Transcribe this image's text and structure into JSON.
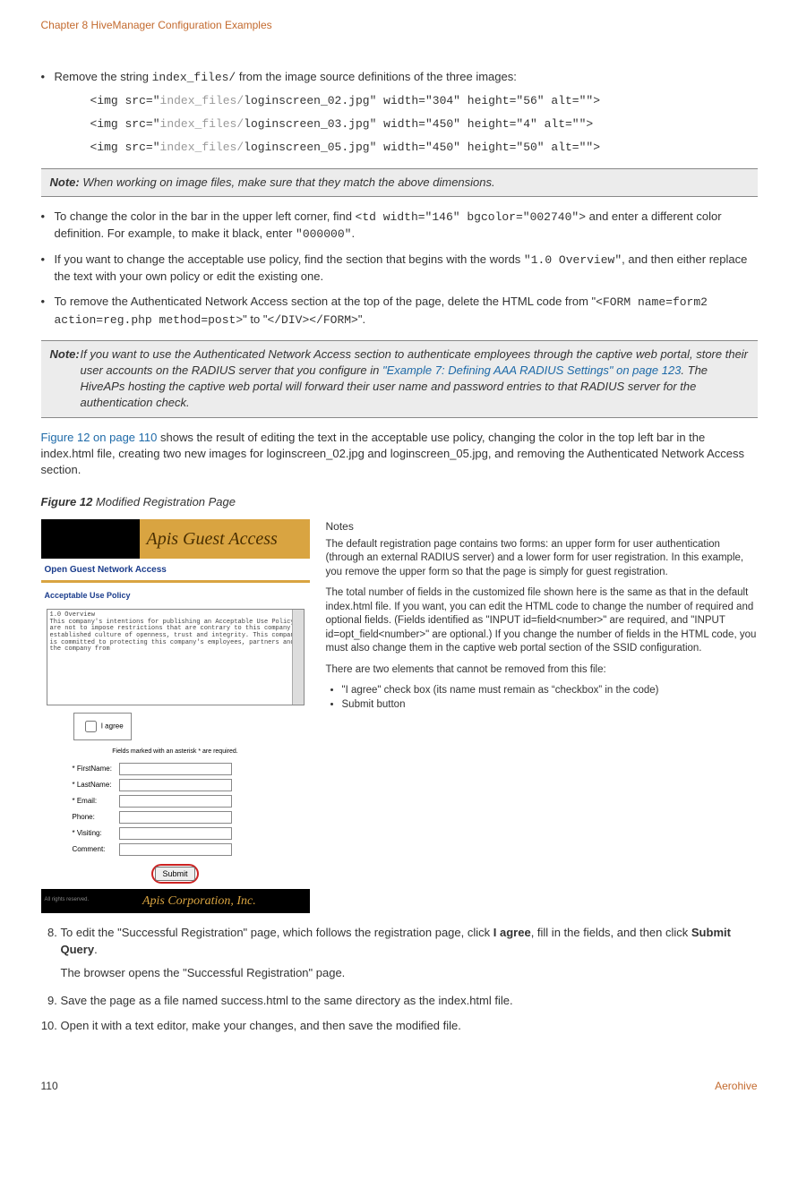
{
  "header": "Chapter 8 HiveManager Configuration Examples",
  "bullets1": {
    "b1_pre": "Remove the string ",
    "b1_code": "index_files/",
    "b1_post": " from the image source definitions of the three images:"
  },
  "code_lines": {
    "l1a": "<img src=\"",
    "l1g": "index_files/",
    "l1b": "loginscreen_02.jpg\" width=\"304\" height=\"56\" alt=\"\">",
    "l2a": "<img src=\"",
    "l2g": "index_files/",
    "l2b": "loginscreen_03.jpg\" width=\"450\" height=\"4\" alt=\"\">",
    "l3a": "<img src=\"",
    "l3g": "index_files/",
    "l3b": "loginscreen_05.jpg\" width=\"450\" height=\"50\" alt=\"\">"
  },
  "note1_label": "Note:",
  "note1_text": " When working on image files, make sure that they match the above dimensions.",
  "bullets2": {
    "b2a": "To change the color in the bar in the upper left corner, find ",
    "b2a_code": "<td width=\"146\" bgcolor=\"002740\">",
    "b2a_mid": " and enter a different color definition. For example, to make it black, enter ",
    "b2a_code2": "\"000000\"",
    "b2a_end": ".",
    "b2b": "If you want to change the acceptable use policy, find the section that begins with the words ",
    "b2b_code": "\"1.0 Overview\"",
    "b2b_end": ", and then either replace the text with your own policy or edit the existing one.",
    "b2c": "To remove the Authenticated Network Access section at the top of the page, delete the HTML code from \"",
    "b2c_code1": "<FORM name=form2 action=reg.php method=post>",
    "b2c_mid": "\" to \"",
    "b2c_code2": "</DIV></FORM>",
    "b2c_end": "\"."
  },
  "note2_label": "Note:",
  "note2_a": " If you want to use the Authenticated Network Access section to authenticate employees through the captive web portal, store their user accounts on the RADIUS server that you configure in ",
  "note2_link": "\"Example 7: Defining AAA RADIUS Settings\" on page 123",
  "note2_b": ". The HiveAPs hosting the captive web portal will forward their user name and password entries to that RADIUS server for the authentication check.",
  "para_fig_a": "Figure 12 on page 110",
  "para_fig_b": " shows the result of editing the text in the acceptable use policy, changing the color in the top left bar in the index.html file, creating two new images for loginscreen_02.jpg and loginscreen_05.jpg, and removing the Authenticated Network Access section.",
  "figure_label_a": "Figure 12",
  "figure_label_b": " Modified Registration Page",
  "reg": {
    "banner": "Apis Guest Access",
    "sub": "Open Guest Network Access",
    "section": "Acceptable Use Policy",
    "policy": "1.0 Overview\nThis company's intentions for publishing an Acceptable Use Policy are not to impose restrictions that are contrary to this company's established culture of openness, trust and integrity. This company is committed to protecting this company's employees, partners and the company from",
    "agree": "I agree",
    "req": "Fields marked with an asterisk * are required.",
    "fields": [
      "* FirstName:",
      "* LastName:",
      "* Email:",
      "Phone:",
      "* Visiting:",
      "Comment:"
    ],
    "submit": "Submit",
    "rights": "All rights reserved.",
    "footer_brand": "Apis Corporation, Inc."
  },
  "notes": {
    "h": "Notes",
    "p1": "The default registration page contains two forms: an upper form for user authentication (through an external RADIUS server) and a lower form for user registration. In this example, you remove the upper form so that the page is simply for guest registration.",
    "p2": "The total number of fields in the customized file shown here is the same as that in the default index.html file. If you want, you can edit the HTML code to change the number of required and optional fields. (Fields identified as \"INPUT id=field<number>\" are required, and \"INPUT id=opt_field<number>\" are optional.) If you change the number of fields in the HTML code, you must also change them in the captive web portal section of the SSID configuration.",
    "p3": "There are two elements that cannot be removed from this file:",
    "li1": "\"I agree\" check box (its name must remain as “checkbox” in the code)",
    "li2": "Submit button"
  },
  "steps": {
    "s8a": "To edit the \"Successful Registration\" page, which follows the registration page, click ",
    "s8b": "I agree",
    "s8c": ", fill in the fields, and then click ",
    "s8d": "Submit Query",
    "s8e": ".",
    "s8f": "The browser opens the \"Successful Registration\" page.",
    "s9": "Save the page as a file named success.html to the same directory as the index.html file.",
    "s10": "Open it with a text editor, make your changes, and then save the modified file."
  },
  "footer": {
    "page": "110",
    "brand": "Aerohive"
  }
}
